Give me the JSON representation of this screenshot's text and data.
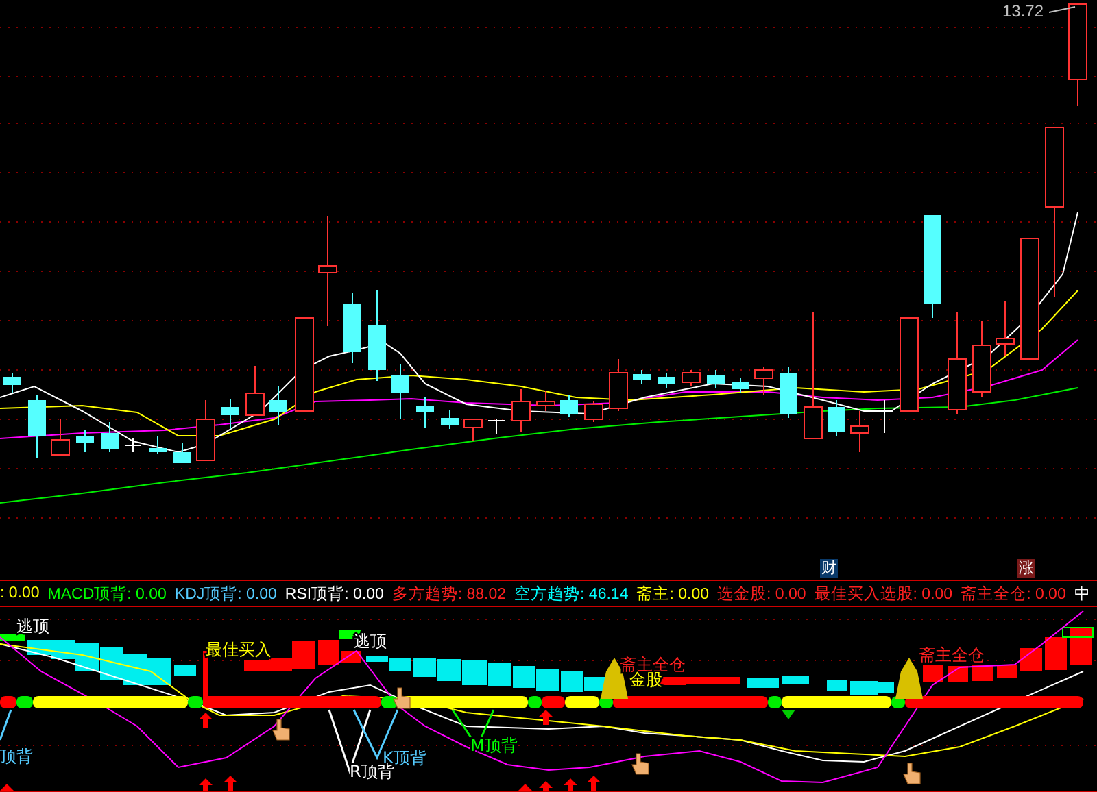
{
  "price_label": "13.72",
  "markers": [
    {
      "text": "财",
      "color": "#0a3a6a"
    },
    {
      "text": "涨",
      "color": "#7a1a1a"
    }
  ],
  "legend": [
    {
      "text": ": 0.00",
      "color": "#ffff00"
    },
    {
      "text": "MACD顶背: 0.00",
      "color": "#00ff00"
    },
    {
      "text": "KDJ顶背: 0.00",
      "color": "#55ccff"
    },
    {
      "text": "RSI顶背: 0.00",
      "color": "#ffffff"
    },
    {
      "text": "多方趋势: 88.02",
      "color": "#ff2020"
    },
    {
      "text": "空方趋势: 46.14",
      "color": "#00ffff"
    },
    {
      "text": "斋主: 0.00",
      "color": "#ffff00"
    },
    {
      "text": "选金股: 0.00",
      "color": "#ff2020"
    },
    {
      "text": "最佳买入选股: 0.00",
      "color": "#ff2020"
    },
    {
      "text": "斋主全仓: 0.00",
      "color": "#ff2020"
    },
    {
      "text": "中",
      "color": "#ffffff"
    }
  ],
  "signal_labels": [
    {
      "text": "逃顶",
      "color": "#ffffff"
    },
    {
      "text": "最佳买入",
      "color": "#ffff00"
    },
    {
      "text": "逃顶",
      "color": "#ffffff"
    },
    {
      "text": "斋主全仓",
      "color": "#ff2020"
    },
    {
      "text": "金股",
      "color": "#ffff00"
    },
    {
      "text": "斋主全仓",
      "color": "#ff2020"
    },
    {
      "text": "顶背",
      "color": "#55ccff"
    },
    {
      "text": "R顶背",
      "color": "#ffffff"
    },
    {
      "text": "K顶背",
      "color": "#55ccff"
    },
    {
      "text": "M顶背",
      "color": "#00ff00"
    }
  ]
}
